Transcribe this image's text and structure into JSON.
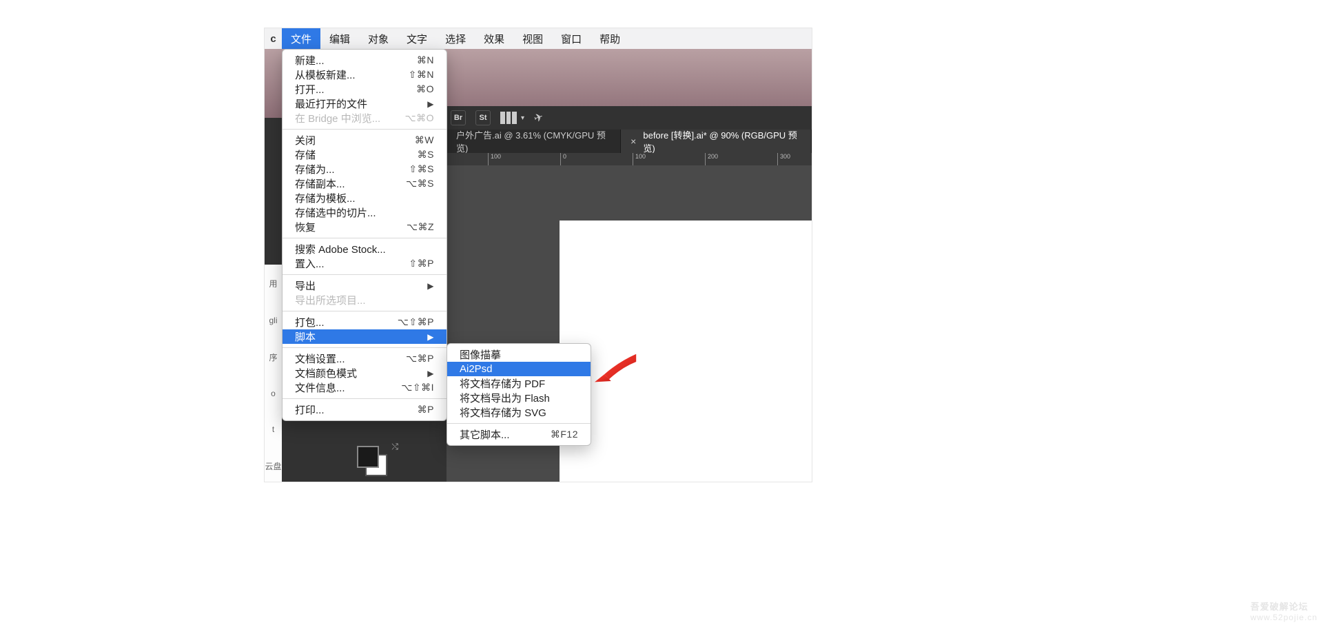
{
  "app_hint": "c",
  "menubar": {
    "items": [
      {
        "label": "文件",
        "active": true
      },
      {
        "label": "编辑"
      },
      {
        "label": "对象"
      },
      {
        "label": "文字"
      },
      {
        "label": "选择"
      },
      {
        "label": "效果"
      },
      {
        "label": "视图"
      },
      {
        "label": "窗口"
      },
      {
        "label": "帮助"
      }
    ]
  },
  "file_menu": {
    "groups": [
      [
        {
          "label": "新建...",
          "shortcut": "⌘N"
        },
        {
          "label": "从模板新建...",
          "shortcut": "⇧⌘N"
        },
        {
          "label": "打开...",
          "shortcut": "⌘O"
        },
        {
          "label": "最近打开的文件",
          "shortcut": "▶"
        },
        {
          "label": "在 Bridge 中浏览...",
          "shortcut": "⌥⌘O",
          "disabled": true
        }
      ],
      [
        {
          "label": "关闭",
          "shortcut": "⌘W"
        },
        {
          "label": "存储",
          "shortcut": "⌘S"
        },
        {
          "label": "存储为...",
          "shortcut": "⇧⌘S"
        },
        {
          "label": "存储副本...",
          "shortcut": "⌥⌘S"
        },
        {
          "label": "存储为模板...",
          "shortcut": ""
        },
        {
          "label": "存储选中的切片...",
          "shortcut": ""
        },
        {
          "label": "恢复",
          "shortcut": "⌥⌘Z"
        }
      ],
      [
        {
          "label": "搜索 Adobe Stock...",
          "shortcut": ""
        },
        {
          "label": "置入...",
          "shortcut": "⇧⌘P"
        }
      ],
      [
        {
          "label": "导出",
          "shortcut": "▶"
        },
        {
          "label": "导出所选项目...",
          "shortcut": "",
          "disabled": true
        }
      ],
      [
        {
          "label": "打包...",
          "shortcut": "⌥⇧⌘P"
        },
        {
          "label": "脚本",
          "shortcut": "▶",
          "highlight": true
        }
      ],
      [
        {
          "label": "文档设置...",
          "shortcut": "⌥⌘P"
        },
        {
          "label": "文档颜色模式",
          "shortcut": "▶"
        },
        {
          "label": "文件信息...",
          "shortcut": "⌥⇧⌘I"
        }
      ],
      [
        {
          "label": "打印...",
          "shortcut": "⌘P"
        }
      ]
    ]
  },
  "script_submenu": {
    "groups": [
      [
        {
          "label": "图像描摹"
        },
        {
          "label": "Ai2Psd",
          "highlight": true
        },
        {
          "label": "将文档存储为 PDF"
        },
        {
          "label": "将文档导出为 Flash"
        },
        {
          "label": "将文档存储为 SVG"
        }
      ],
      [
        {
          "label": "其它脚本...",
          "shortcut": "⌘F12"
        }
      ]
    ]
  },
  "options_bar": {
    "chip1": "Br",
    "chip2": "St"
  },
  "tabs": [
    {
      "label": "户外广告.ai @ 3.61% (CMYK/GPU 预览)",
      "close": "×",
      "active": false
    },
    {
      "label": "before [转换].ai* @ 90% (RGB/GPU 预览)",
      "close": "×",
      "active": true
    }
  ],
  "ruler_ticks": [
    "100",
    "0",
    "100",
    "200",
    "300"
  ],
  "left_hints": [
    "用",
    "gli",
    "序",
    "o",
    "t",
    "云盘"
  ],
  "watermark": {
    "top": "吾爱破解论坛",
    "bottom": "www.52pojie.cn"
  }
}
